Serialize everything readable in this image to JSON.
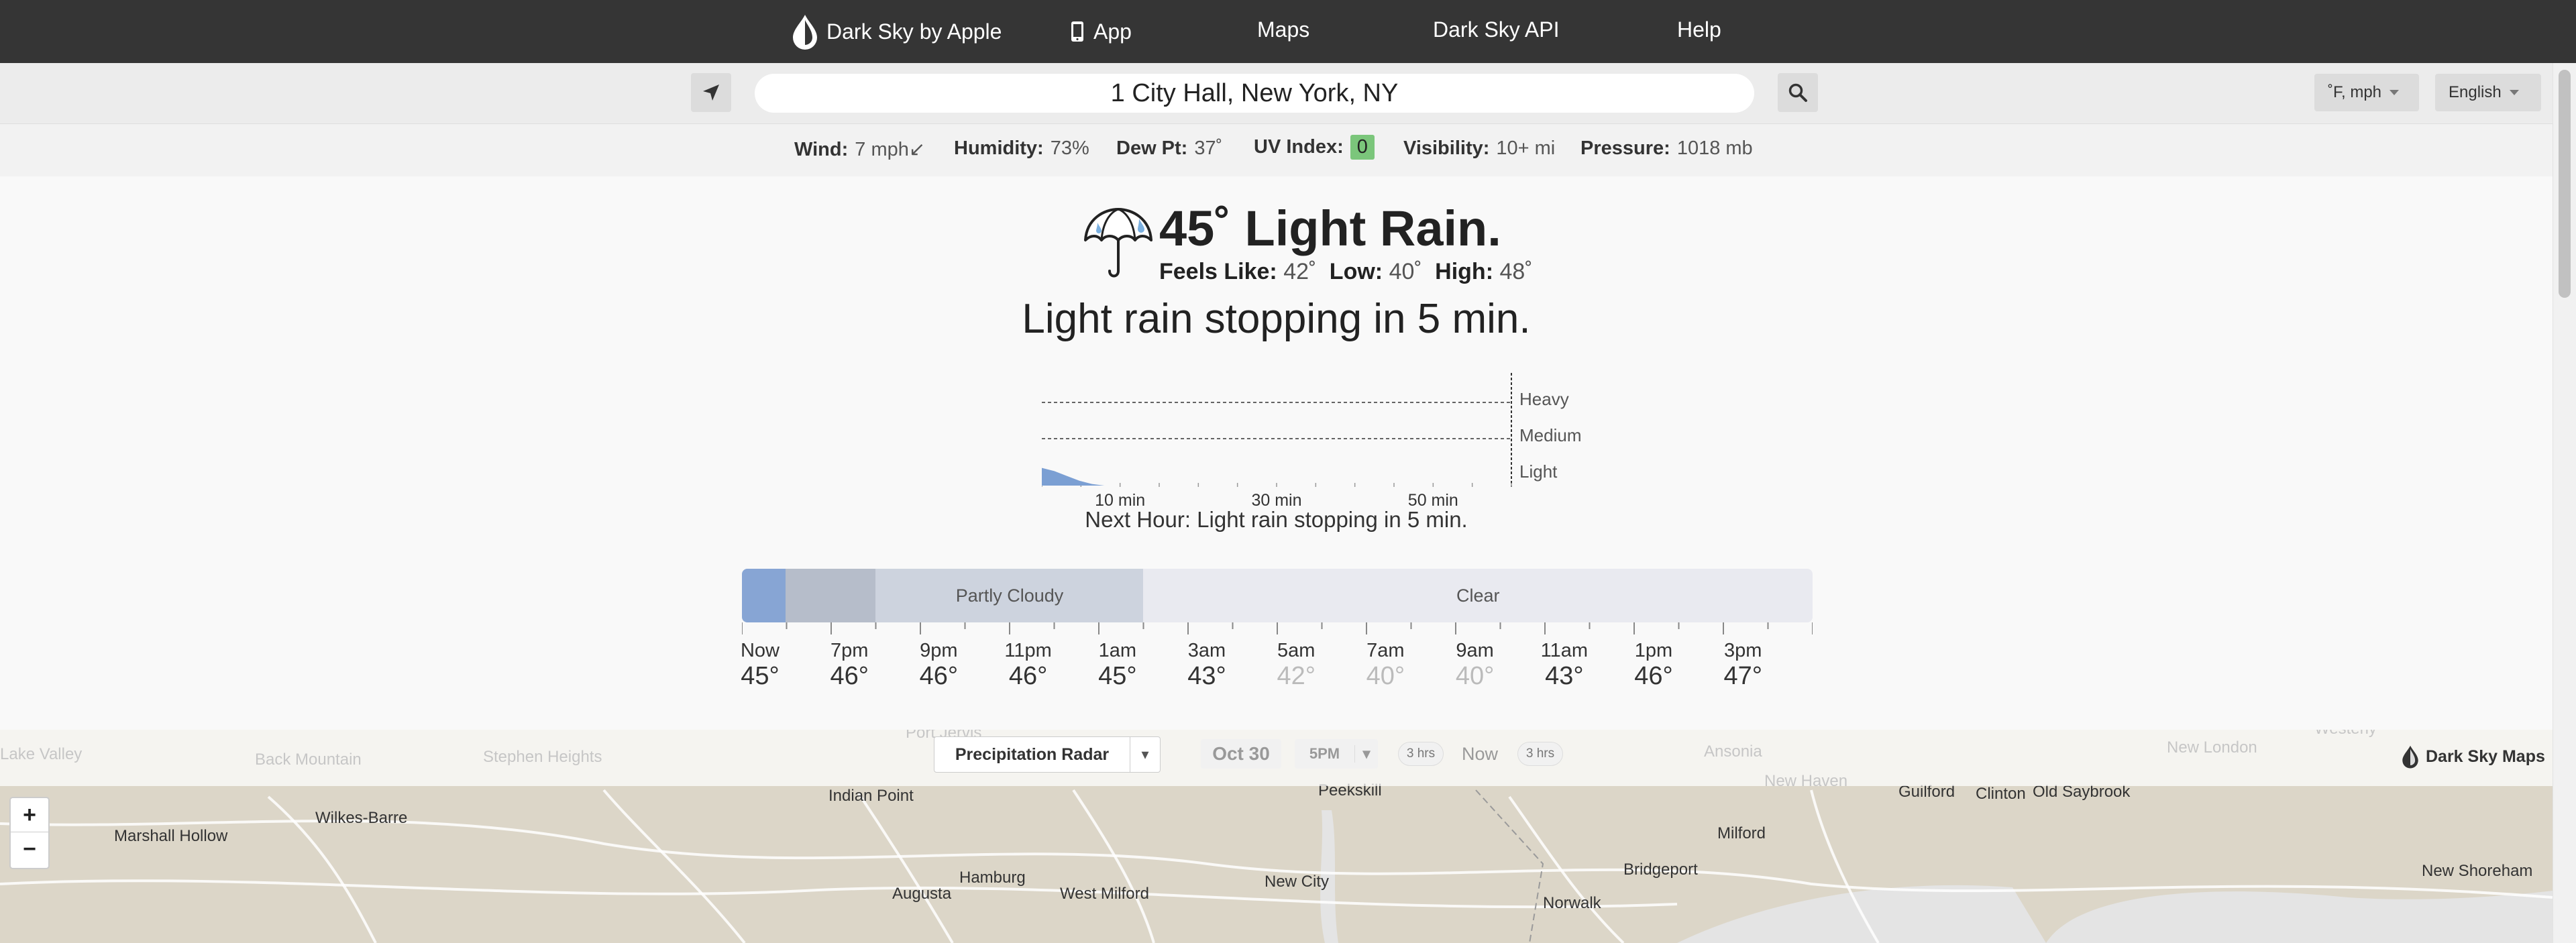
{
  "nav": {
    "brand": "Dark Sky by Apple",
    "app": "App",
    "maps": "Maps",
    "api": "Dark Sky API",
    "help": "Help"
  },
  "search": {
    "value": "1 City Hall, New York, NY",
    "units": "˚F, mph",
    "language": "English"
  },
  "stats": {
    "wind_label": "Wind:",
    "wind_value": "7 mph↙",
    "humidity_label": "Humidity:",
    "humidity_value": "73%",
    "dew_label": "Dew Pt:",
    "dew_value": "37˚",
    "uv_label": "UV Index:",
    "uv_value": "0",
    "visibility_label": "Visibility:",
    "visibility_value": "10+ mi",
    "pressure_label": "Pressure:",
    "pressure_value": "1018 mb"
  },
  "current": {
    "title": "45˚ Light Rain.",
    "feels_label": "Feels Like:",
    "feels_value": "42˚",
    "low_label": "Low:",
    "low_value": "40˚",
    "high_label": "High:",
    "high_value": "48˚",
    "icon": "umbrella-icon"
  },
  "minutely": {
    "summary": "Light rain stopping in 5 min.",
    "next_hour": "Next Hour: Light rain stopping in 5 min.",
    "levels": [
      "Heavy",
      "Medium",
      "Light"
    ],
    "x_labels": [
      "10 min",
      "30 min",
      "50 min"
    ],
    "intensity": [
      0.55,
      0.45,
      0.3,
      0.15,
      0.05,
      0,
      0,
      0,
      0,
      0,
      0,
      0
    ],
    "color": "#7b9fd3"
  },
  "timeline": {
    "segments": [
      {
        "label": "",
        "fraction": 0.041,
        "color": "#87a5d4"
      },
      {
        "label": "",
        "fraction": 0.084,
        "color": "#b6bdca"
      },
      {
        "label": "Partly Cloudy",
        "fraction": 0.25,
        "color": "#cdd3de"
      },
      {
        "label": "Clear",
        "fraction": 0.625,
        "color": "#e9eaf0"
      }
    ],
    "hours": [
      {
        "label": "Now",
        "temp": "45°",
        "dim": false
      },
      {
        "label": "7pm",
        "temp": "46°",
        "dim": false
      },
      {
        "label": "9pm",
        "temp": "46°",
        "dim": false
      },
      {
        "label": "11pm",
        "temp": "46°",
        "dim": false
      },
      {
        "label": "1am",
        "temp": "45°",
        "dim": false
      },
      {
        "label": "3am",
        "temp": "43°",
        "dim": false
      },
      {
        "label": "5am",
        "temp": "42°",
        "dim": true
      },
      {
        "label": "7am",
        "temp": "40°",
        "dim": true
      },
      {
        "label": "9am",
        "temp": "40°",
        "dim": true
      },
      {
        "label": "11am",
        "temp": "43°",
        "dim": false
      },
      {
        "label": "1pm",
        "temp": "46°",
        "dim": false
      },
      {
        "label": "3pm",
        "temp": "47°",
        "dim": false
      }
    ]
  },
  "map": {
    "layer": "Precipitation Radar",
    "date": "Oct 30",
    "time": "5PM",
    "back_step": "3 hrs",
    "now": "Now",
    "forward_step": "3 hrs",
    "credit": "Dark Sky Maps",
    "zoom_in": "+",
    "zoom_out": "−",
    "places": [
      "Marshall Hollow",
      "Wilkes-Barre",
      "Indian Point",
      "Peekskill",
      "Guilford",
      "Clinton",
      "Old Saybrook",
      "Milford",
      "Bridgeport",
      "New Shoreham",
      "Augusta",
      "Hamburg",
      "West Milford",
      "New City",
      "Norwalk",
      "Back Mountain",
      "Stephen Heights",
      "Port Jervis",
      "Ansonia",
      "New Haven",
      "New London",
      "Westerly",
      "Lake Valley"
    ]
  }
}
